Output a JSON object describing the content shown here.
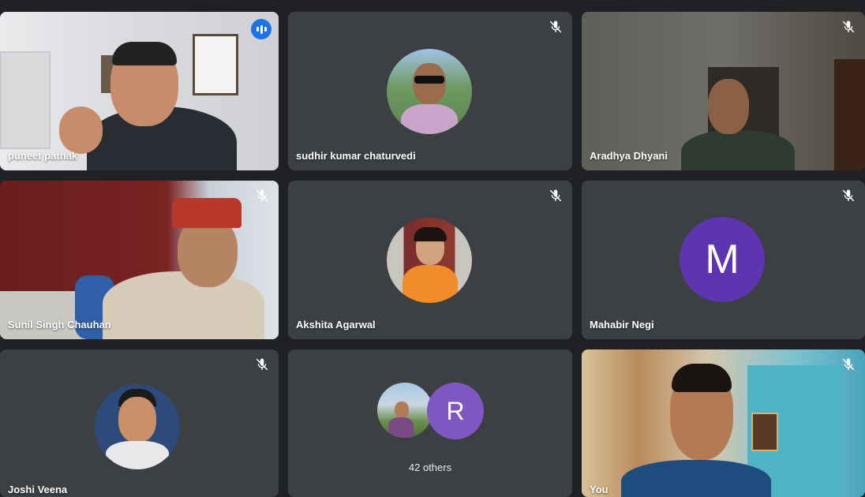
{
  "participants": [
    {
      "name": "puneet pathak",
      "speaking": true
    },
    {
      "name": "sudhir kumar chaturvedi",
      "muted": true
    },
    {
      "name": "Aradhya Dhyani",
      "muted": true
    },
    {
      "name": "Sunil Singh Chauhan",
      "muted": true
    },
    {
      "name": "Akshita Agarwal",
      "muted": true
    },
    {
      "name": "Mahabir Negi",
      "muted": true,
      "initial": "M"
    },
    {
      "name": "Joshi Veena",
      "muted": true
    },
    {
      "others_initial": "R",
      "others_label": "42 others"
    },
    {
      "name": "You",
      "muted": true
    }
  ],
  "colors": {
    "background": "#202124",
    "tile": "#3c4043",
    "active_border": "#8ab4f8",
    "speaking_badge": "#1a73e8",
    "avatar_purple_m": "#5e35b1",
    "avatar_purple_r": "#7e57c2"
  },
  "icons": [
    "mic-off-icon",
    "speaking-indicator-icon"
  ]
}
